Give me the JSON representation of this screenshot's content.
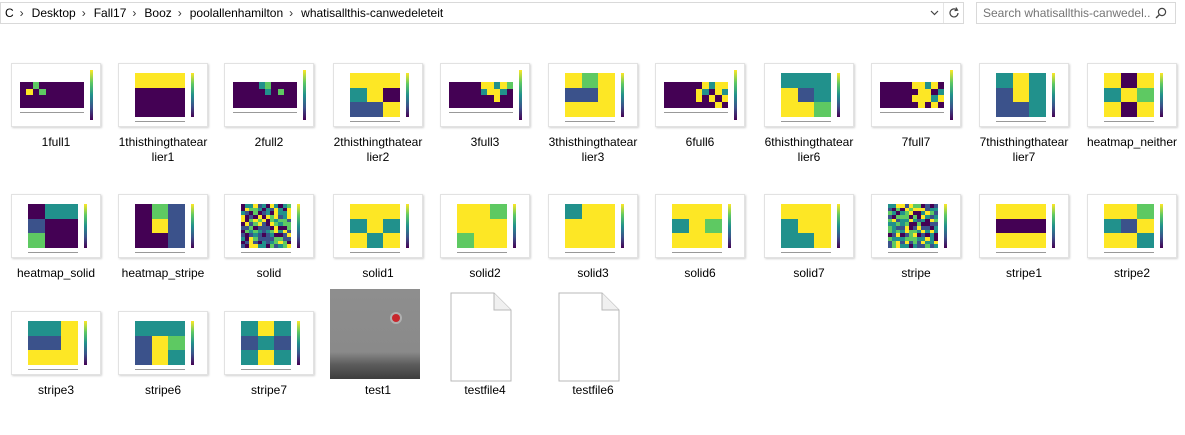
{
  "address": {
    "crumbs": [
      "C",
      "Desktop",
      "Fall17",
      "Booz",
      "poolallenhamilton",
      "whatisallthis-canwedeleteit"
    ]
  },
  "search": {
    "placeholder": "Search whatisallthis-canwedel..."
  },
  "colors": {
    "viridis": [
      "#440154",
      "#3b528b",
      "#21918c",
      "#5ec962",
      "#fde725"
    ]
  },
  "files": [
    {
      "name": "1full1",
      "kind": "heatmap-wide"
    },
    {
      "name": "1thisthingthatearlier1",
      "kind": "heatmap"
    },
    {
      "name": "2full2",
      "kind": "heatmap-wide"
    },
    {
      "name": "2thisthingthatearlier2",
      "kind": "heatmap"
    },
    {
      "name": "3full3",
      "kind": "heatmap-wide"
    },
    {
      "name": "3thisthingthatearlier3",
      "kind": "heatmap"
    },
    {
      "name": "6full6",
      "kind": "heatmap-wide"
    },
    {
      "name": "6thisthingthatearlier6",
      "kind": "heatmap"
    },
    {
      "name": "7full7",
      "kind": "heatmap-wide"
    },
    {
      "name": "7thisthingthatearlier7",
      "kind": "heatmap"
    },
    {
      "name": "heatmap_neither",
      "kind": "heatmap"
    },
    {
      "name": "heatmap_solid",
      "kind": "heatmap"
    },
    {
      "name": "heatmap_stripe",
      "kind": "heatmap"
    },
    {
      "name": "solid",
      "kind": "heatmap-noise"
    },
    {
      "name": "solid1",
      "kind": "heatmap"
    },
    {
      "name": "solid2",
      "kind": "heatmap"
    },
    {
      "name": "solid3",
      "kind": "heatmap"
    },
    {
      "name": "solid6",
      "kind": "heatmap"
    },
    {
      "name": "solid7",
      "kind": "heatmap"
    },
    {
      "name": "stripe",
      "kind": "heatmap-noise"
    },
    {
      "name": "stripe1",
      "kind": "heatmap"
    },
    {
      "name": "stripe2",
      "kind": "heatmap"
    },
    {
      "name": "stripe3",
      "kind": "heatmap"
    },
    {
      "name": "stripe6",
      "kind": "heatmap"
    },
    {
      "name": "stripe7",
      "kind": "heatmap"
    },
    {
      "name": "test1",
      "kind": "photo"
    },
    {
      "name": "testfile4",
      "kind": "blank-file"
    },
    {
      "name": "testfile6",
      "kind": "blank-file"
    }
  ],
  "labels_wrapped": {
    "1thisthingthatearlier1": [
      "1thisthingthatear",
      "lier1"
    ],
    "2thisthingthatearlier2": [
      "2thisthingthatear",
      "lier2"
    ],
    "3thisthingthatearlier3": [
      "3thisthingthatear",
      "lier3"
    ],
    "6thisthingthatearlier6": [
      "6thisthingthatear",
      "lier6"
    ],
    "7thisthingthatearlier7": [
      "7thisthingthatear",
      "lier7"
    ]
  },
  "patterns": {
    "1full1": [
      [
        0,
        0,
        3,
        0,
        0,
        0,
        0,
        0,
        0,
        0
      ],
      [
        0,
        4,
        0,
        3,
        0,
        0,
        0,
        0,
        0,
        0
      ],
      [
        0,
        0,
        0,
        0,
        0,
        0,
        0,
        0,
        0,
        0
      ],
      [
        0,
        0,
        0,
        0,
        0,
        0,
        0,
        0,
        0,
        0
      ]
    ],
    "1thisthingthatearlier1": [
      [
        4,
        4,
        4
      ],
      [
        0,
        0,
        0
      ],
      [
        0,
        0,
        0
      ]
    ],
    "2full2": [
      [
        0,
        0,
        0,
        0,
        2,
        3,
        0,
        0,
        0,
        0
      ],
      [
        0,
        0,
        0,
        0,
        0,
        2,
        0,
        3,
        0,
        0
      ],
      [
        0,
        0,
        0,
        0,
        0,
        0,
        0,
        0,
        0,
        0
      ],
      [
        0,
        0,
        0,
        0,
        0,
        0,
        0,
        0,
        0,
        0
      ]
    ],
    "2thisthingthatearlier2": [
      [
        4,
        4,
        4
      ],
      [
        2,
        4,
        0
      ],
      [
        1,
        1,
        4
      ]
    ],
    "3full3": [
      [
        0,
        0,
        0,
        0,
        0,
        4,
        4,
        2,
        4,
        3
      ],
      [
        0,
        0,
        0,
        0,
        0,
        2,
        4,
        4,
        2,
        0
      ],
      [
        0,
        0,
        0,
        0,
        0,
        0,
        0,
        4,
        0,
        0
      ],
      [
        0,
        0,
        0,
        0,
        0,
        0,
        0,
        0,
        0,
        0
      ]
    ],
    "3thisthingthatearlier3": [
      [
        4,
        3,
        4
      ],
      [
        1,
        1,
        4
      ],
      [
        4,
        4,
        4
      ]
    ],
    "6full6": [
      [
        0,
        0,
        0,
        0,
        0,
        0,
        4,
        2,
        4,
        4
      ],
      [
        0,
        0,
        0,
        0,
        0,
        4,
        2,
        0,
        4,
        2
      ],
      [
        0,
        0,
        0,
        0,
        0,
        4,
        0,
        4,
        0,
        4
      ],
      [
        0,
        0,
        0,
        0,
        0,
        0,
        0,
        0,
        4,
        0
      ]
    ],
    "6thisthingthatearlier6": [
      [
        2,
        2,
        2
      ],
      [
        4,
        1,
        2
      ],
      [
        4,
        4,
        3
      ]
    ],
    "7full7": [
      [
        0,
        0,
        0,
        0,
        0,
        4,
        4,
        2,
        4,
        0
      ],
      [
        0,
        0,
        0,
        0,
        0,
        0,
        4,
        4,
        0,
        2
      ],
      [
        0,
        0,
        0,
        0,
        0,
        4,
        4,
        4,
        2,
        4
      ],
      [
        0,
        0,
        0,
        0,
        0,
        0,
        4,
        0,
        4,
        0
      ]
    ],
    "7thisthingthatearlier7": [
      [
        2,
        4,
        2
      ],
      [
        1,
        4,
        2
      ],
      [
        1,
        1,
        2
      ]
    ],
    "heatmap_neither": [
      [
        4,
        0,
        4
      ],
      [
        2,
        4,
        3
      ],
      [
        4,
        0,
        4
      ]
    ],
    "heatmap_solid": [
      [
        0,
        2,
        2
      ],
      [
        1,
        0,
        0
      ],
      [
        3,
        0,
        0
      ]
    ],
    "heatmap_stripe": [
      [
        0,
        3,
        1
      ],
      [
        0,
        4,
        1
      ],
      [
        0,
        0,
        1
      ]
    ],
    "solid1": [
      [
        4,
        4,
        4
      ],
      [
        2,
        4,
        2
      ],
      [
        4,
        2,
        4
      ]
    ],
    "solid2": [
      [
        4,
        4,
        3
      ],
      [
        4,
        4,
        4
      ],
      [
        3,
        4,
        4
      ]
    ],
    "solid3": [
      [
        2,
        4,
        4
      ],
      [
        4,
        4,
        4
      ],
      [
        4,
        4,
        4
      ]
    ],
    "solid6": [
      [
        4,
        4,
        4
      ],
      [
        2,
        4,
        3
      ],
      [
        4,
        4,
        4
      ]
    ],
    "solid7": [
      [
        4,
        4,
        4
      ],
      [
        2,
        4,
        4
      ],
      [
        2,
        2,
        4
      ]
    ],
    "stripe1": [
      [
        4,
        4,
        4
      ],
      [
        0,
        0,
        0
      ],
      [
        4,
        4,
        4
      ]
    ],
    "stripe2": [
      [
        4,
        4,
        3
      ],
      [
        2,
        1,
        4
      ],
      [
        4,
        4,
        2
      ]
    ],
    "stripe3": [
      [
        2,
        2,
        4
      ],
      [
        1,
        1,
        4
      ],
      [
        4,
        4,
        4
      ]
    ],
    "stripe6": [
      [
        2,
        2,
        2
      ],
      [
        1,
        4,
        3
      ],
      [
        1,
        4,
        2
      ]
    ],
    "stripe7": [
      [
        2,
        4,
        2
      ],
      [
        1,
        2,
        1
      ],
      [
        2,
        4,
        2
      ]
    ]
  }
}
